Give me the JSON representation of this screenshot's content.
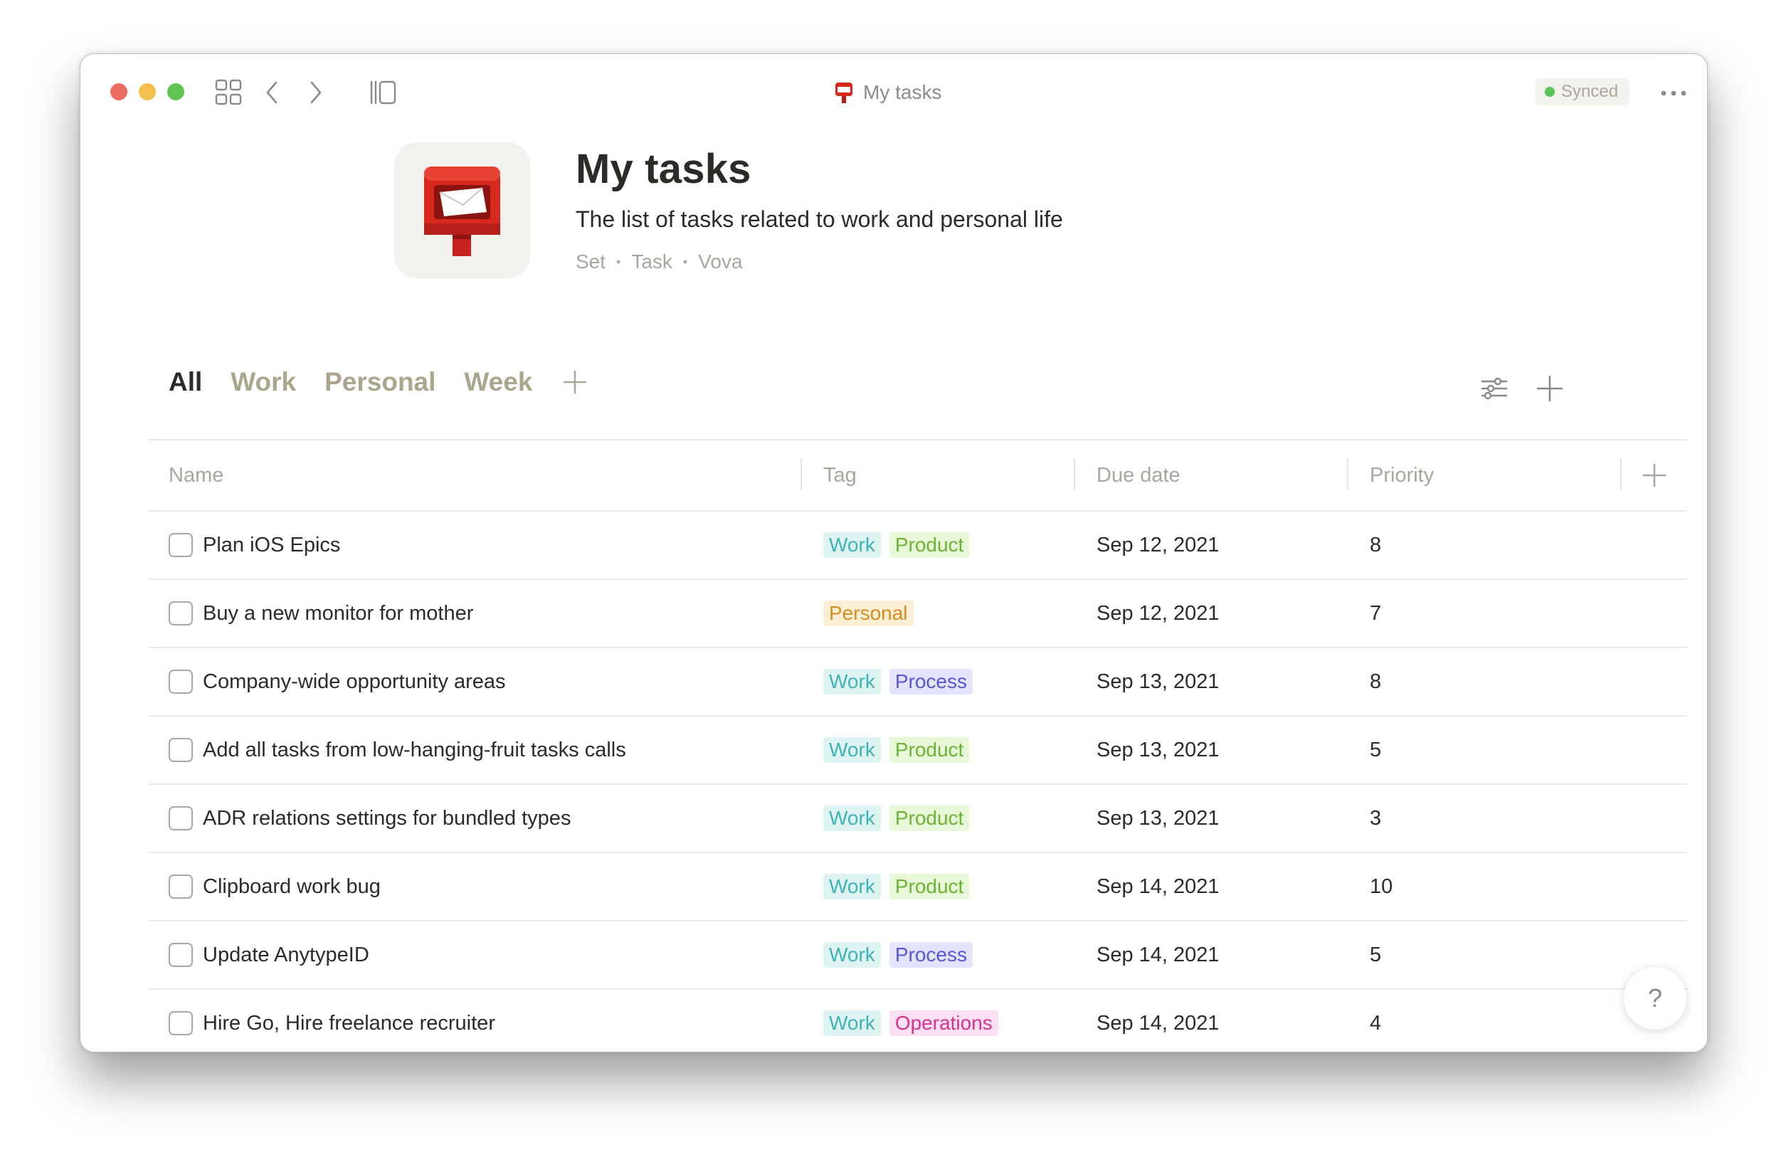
{
  "window": {
    "title": "My tasks",
    "sync_status": "Synced",
    "icons": [
      "dashboard-icon",
      "back-icon",
      "forward-icon",
      "sidebar-icon",
      "more-icon"
    ]
  },
  "header": {
    "title": "My tasks",
    "description": "The list of tasks related to work and personal life",
    "meta": [
      "Set",
      "Task",
      "Vova"
    ],
    "icon": "postbox-emoji"
  },
  "tabs": [
    {
      "label": "All",
      "active": true
    },
    {
      "label": "Work",
      "active": false
    },
    {
      "label": "Personal",
      "active": false
    },
    {
      "label": "Week",
      "active": false
    }
  ],
  "table": {
    "columns": [
      "Name",
      "Tag",
      "Due date",
      "Priority"
    ],
    "rows": [
      {
        "name": "Plan iOS Epics",
        "tags": [
          {
            "label": "Work",
            "color": "teal"
          },
          {
            "label": "Product",
            "color": "lime"
          }
        ],
        "due": "Sep 12, 2021",
        "priority": "8"
      },
      {
        "name": "Buy a new monitor for mother",
        "tags": [
          {
            "label": "Personal",
            "color": "orange"
          }
        ],
        "due": "Sep 12, 2021",
        "priority": "7"
      },
      {
        "name": "Company-wide opportunity areas",
        "tags": [
          {
            "label": "Work",
            "color": "teal"
          },
          {
            "label": "Process",
            "color": "purple"
          }
        ],
        "due": "Sep 13, 2021",
        "priority": "8"
      },
      {
        "name": "Add all tasks from low-hanging-fruit tasks calls",
        "tags": [
          {
            "label": "Work",
            "color": "teal"
          },
          {
            "label": "Product",
            "color": "lime"
          }
        ],
        "due": "Sep 13, 2021",
        "priority": "5"
      },
      {
        "name": "ADR relations settings for bundled types",
        "tags": [
          {
            "label": "Work",
            "color": "teal"
          },
          {
            "label": "Product",
            "color": "lime"
          }
        ],
        "due": "Sep 13, 2021",
        "priority": "3"
      },
      {
        "name": "Clipboard work bug",
        "tags": [
          {
            "label": "Work",
            "color": "teal"
          },
          {
            "label": "Product",
            "color": "lime"
          }
        ],
        "due": "Sep 14, 2021",
        "priority": "10"
      },
      {
        "name": "Update AnytypeID",
        "tags": [
          {
            "label": "Work",
            "color": "teal"
          },
          {
            "label": "Process",
            "color": "purple"
          }
        ],
        "due": "Sep 14, 2021",
        "priority": "5",
        "hovered": true
      },
      {
        "name": "Hire Go, Hire freelance recruiter",
        "tags": [
          {
            "label": "Work",
            "color": "teal"
          },
          {
            "label": "Operations",
            "color": "pink"
          }
        ],
        "due": "Sep 14, 2021",
        "priority": "4"
      }
    ]
  },
  "help": {
    "label": "?"
  }
}
